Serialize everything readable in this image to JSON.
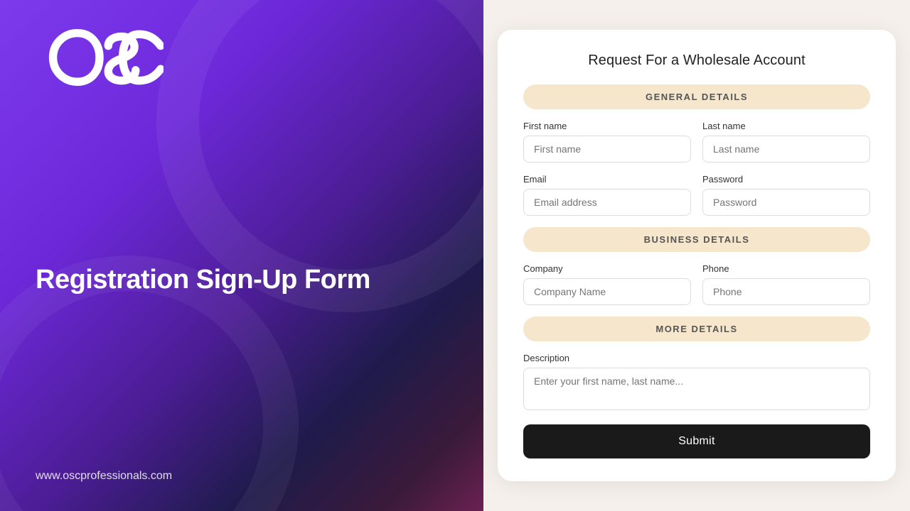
{
  "left": {
    "logo_alt": "OSC Logo",
    "tagline": "Registration Sign-Up Form",
    "website": "www.oscprofessionals.com"
  },
  "form": {
    "title": "Request For a Wholesale Account",
    "sections": {
      "general": {
        "header": "GENERAL DETAILS",
        "fields": {
          "first_name_label": "First name",
          "first_name_placeholder": "First name",
          "last_name_label": "Last name",
          "last_name_placeholder": "Last name",
          "email_label": "Email",
          "email_placeholder": "Email address",
          "password_label": "Password",
          "password_placeholder": "Password"
        }
      },
      "business": {
        "header": "BUSINESS DETAILS",
        "fields": {
          "company_label": "Company",
          "company_placeholder": "Company Name",
          "phone_label": "Phone",
          "phone_placeholder": "Phone"
        }
      },
      "more": {
        "header": "MORE DETAILS",
        "fields": {
          "description_label": "Description",
          "description_placeholder": "Enter your first name, last name..."
        }
      }
    },
    "submit_label": "Submit"
  }
}
